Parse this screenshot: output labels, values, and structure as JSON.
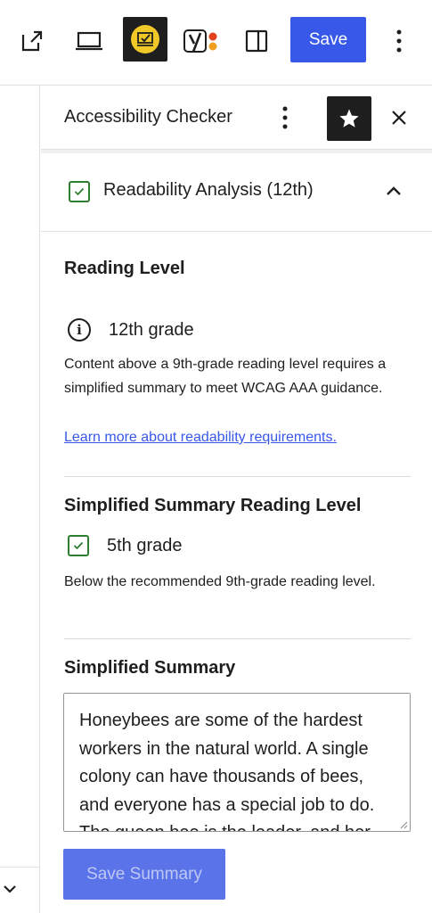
{
  "toolbar": {
    "save_label": "Save"
  },
  "sidebar": {
    "title": "Accessibility Checker",
    "panel": {
      "title": "Readability Analysis (12th)"
    },
    "reading_level": {
      "heading": "Reading Level",
      "value": "12th grade",
      "description": "Content above a 9th-grade reading level requires a simplified summary to meet WCAG AAA guidance.",
      "link_text": "Learn more about readability requirements."
    },
    "summary_level": {
      "heading": "Simplified Summary Reading Level",
      "value": "5th grade",
      "description": "Below the recommended 9th-grade reading level."
    },
    "summary": {
      "heading": "Simplified Summary",
      "text": "Honeybees are some of the hardest workers in the natural world. A single colony can have thousands of bees, and everyone has a special job to do. The queen bee is the leader, and her",
      "save_label": "Save Summary"
    }
  },
  "colors": {
    "accent": "#3858e9",
    "check_green": "#2e7d32",
    "highlight_yellow": "#f0c929",
    "dark": "#1e1e1e"
  },
  "icons": [
    "external-link-icon",
    "desktop-preview-icon",
    "accessibility-checker-icon",
    "yoast-icon",
    "sidebar-toggle-icon",
    "more-vertical-icon",
    "star-icon",
    "close-icon",
    "check-icon",
    "chevron-up-icon",
    "info-icon",
    "chevron-down-icon"
  ]
}
